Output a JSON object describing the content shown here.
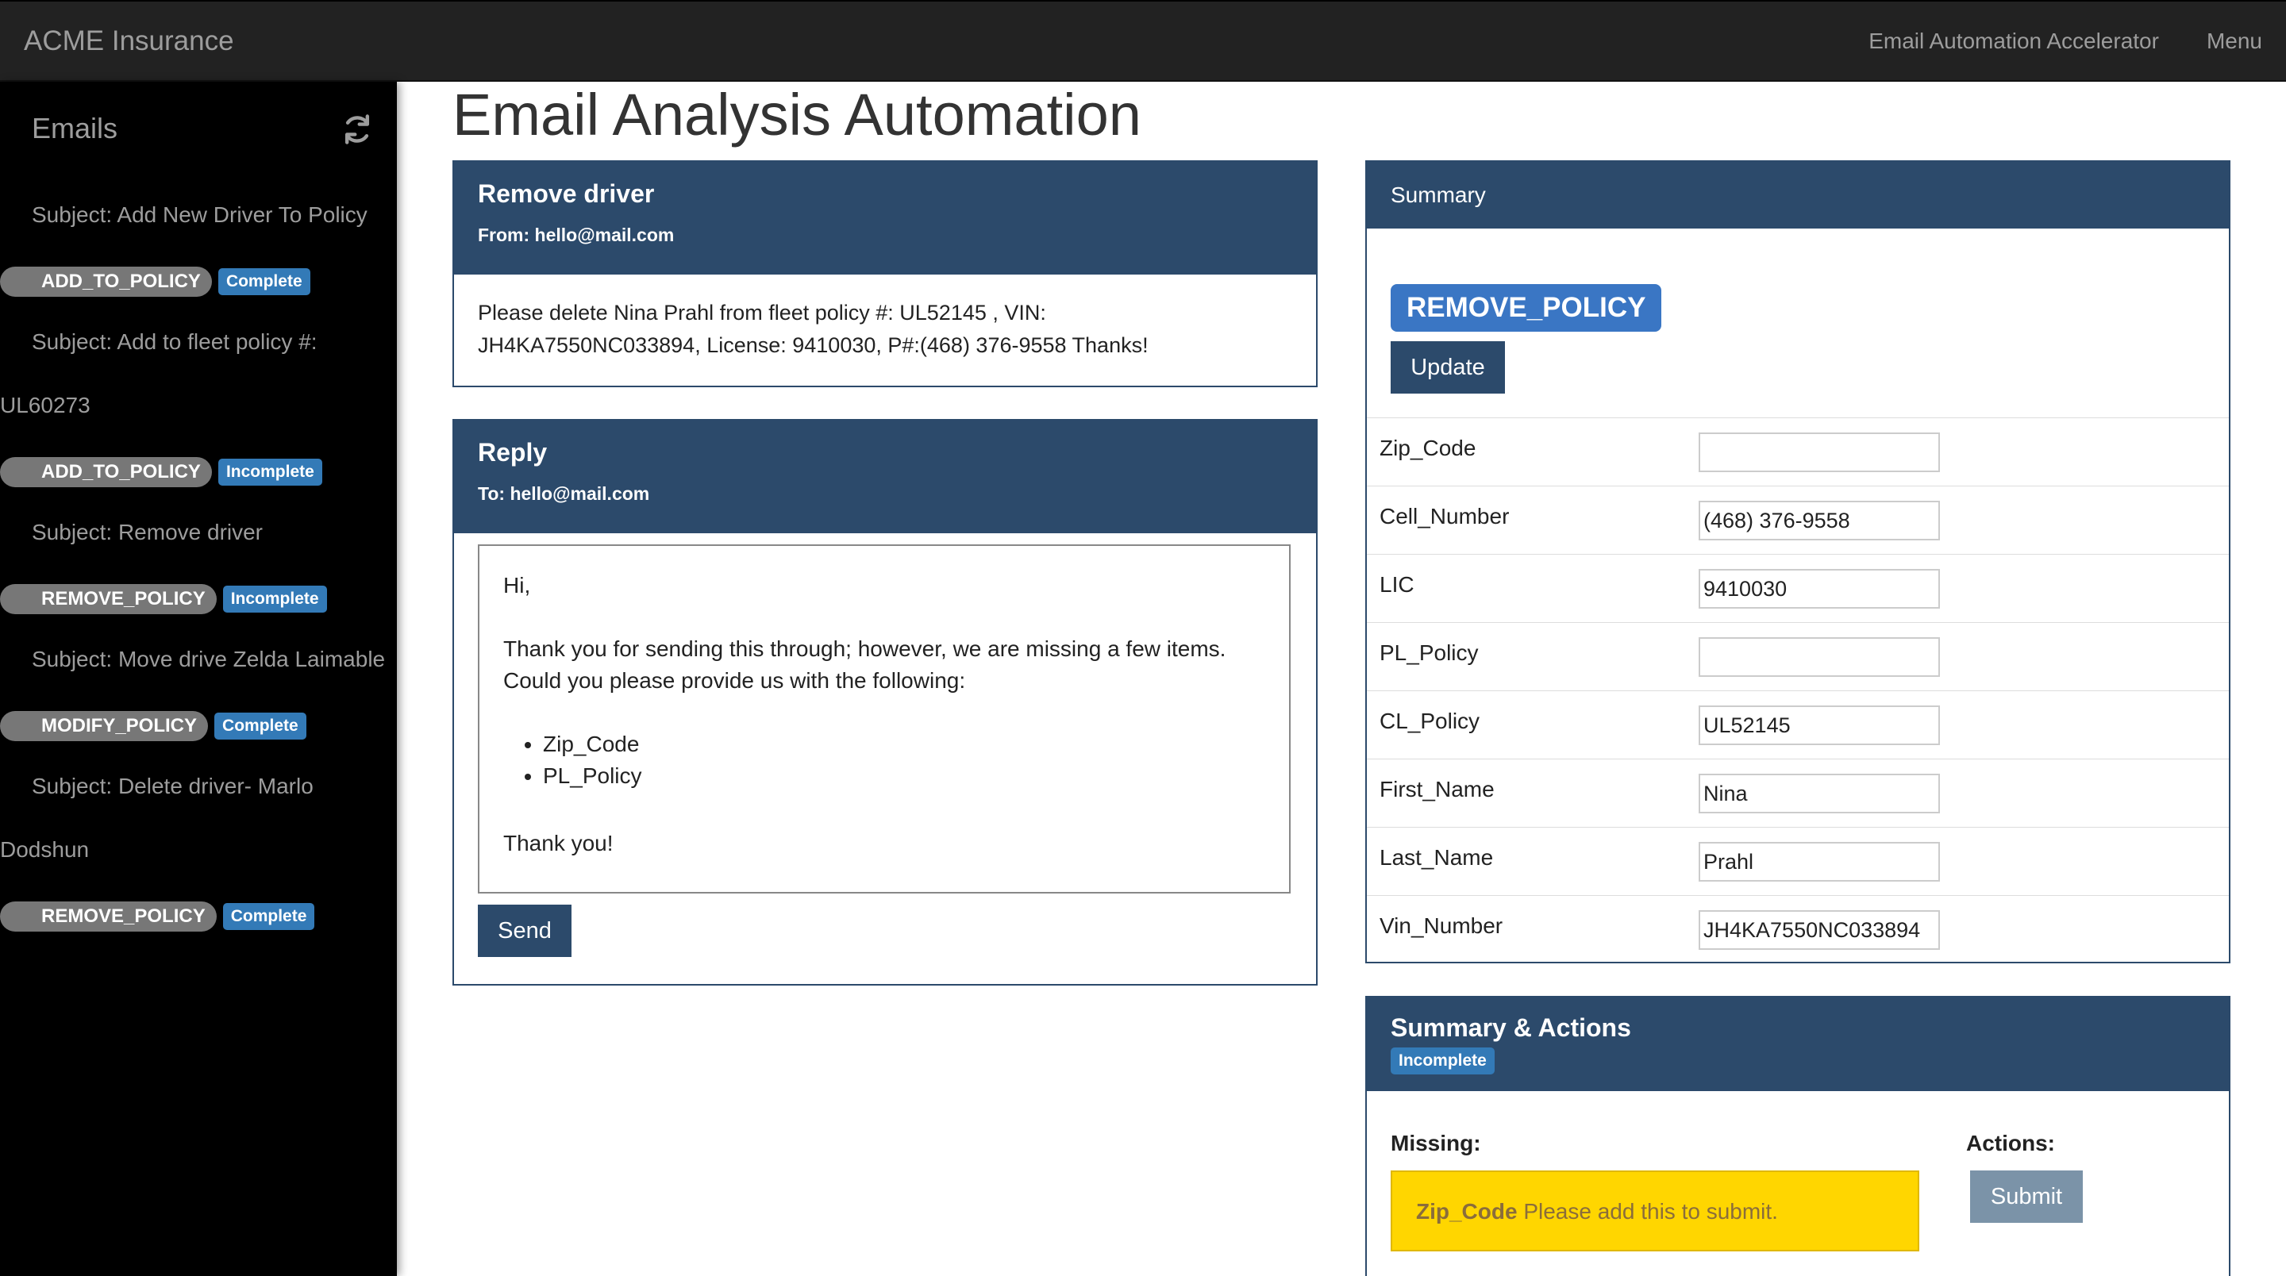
{
  "navbar": {
    "brand": "ACME Insurance",
    "links": [
      "Email Automation Accelerator",
      "Menu"
    ]
  },
  "sidebar": {
    "title": "Emails",
    "refresh_icon": "refresh-icon",
    "emails": [
      {
        "subject_lines": [
          "Subject: Add New Driver To Policy"
        ],
        "category": "ADD_TO_POLICY",
        "status": "Complete"
      },
      {
        "subject_lines": [
          "Subject: Add to fleet policy #:",
          "UL60273"
        ],
        "category": "ADD_TO_POLICY",
        "status": "Incomplete"
      },
      {
        "subject_lines": [
          "Subject: Remove driver"
        ],
        "category": "REMOVE_POLICY",
        "status": "Incomplete"
      },
      {
        "subject_lines": [
          "Subject: Move drive Zelda Laimable"
        ],
        "category": "MODIFY_POLICY",
        "status": "Complete"
      },
      {
        "subject_lines": [
          "Subject: Delete driver- Marlo",
          "Dodshun"
        ],
        "category": "REMOVE_POLICY",
        "status": "Complete"
      }
    ]
  },
  "main": {
    "title": "Email Analysis Automation",
    "email": {
      "subject": "Remove driver",
      "from": "From: hello@mail.com",
      "body_lines": [
        "Please delete Nina Prahl from fleet policy #: UL52145 , VIN:",
        "JH4KA7550NC033894, License: 9410030, P#:(468) 376-9558 Thanks!"
      ]
    },
    "reply": {
      "title": "Reply",
      "to": "To: hello@mail.com",
      "greeting": "Hi,",
      "body_lines": [
        "Thank you for sending this through; however, we are missing a few items.",
        "Could you please provide us with the following:"
      ],
      "items": [
        "Zip_Code",
        "PL_Policy"
      ],
      "closing": "Thank you!",
      "send_label": "Send"
    },
    "summary": {
      "title": "Summary",
      "type": "REMOVE_POLICY",
      "update_label": "Update",
      "fields": [
        {
          "label": "Zip_Code",
          "value": ""
        },
        {
          "label": "Cell_Number",
          "value": "(468) 376-9558"
        },
        {
          "label": "LIC",
          "value": "9410030"
        },
        {
          "label": "PL_Policy",
          "value": ""
        },
        {
          "label": "CL_Policy",
          "value": "UL52145"
        },
        {
          "label": "First_Name",
          "value": "Nina"
        },
        {
          "label": "Last_Name",
          "value": "Prahl"
        },
        {
          "label": "Vin_Number",
          "value": "JH4KA7550NC033894"
        }
      ]
    },
    "actions": {
      "title": "Summary & Actions",
      "status": "Incomplete",
      "missing_label": "Missing:",
      "actions_label": "Actions:",
      "missing_field": "Zip_Code",
      "missing_message": " Please add this to submit.",
      "submit_label": "Submit"
    }
  },
  "colors": {
    "navbar": "#222222",
    "sidebar": "#000000",
    "panel_header": "#2c4a6b",
    "badge_blue": "#337ab7",
    "warning": "#ffd600"
  }
}
